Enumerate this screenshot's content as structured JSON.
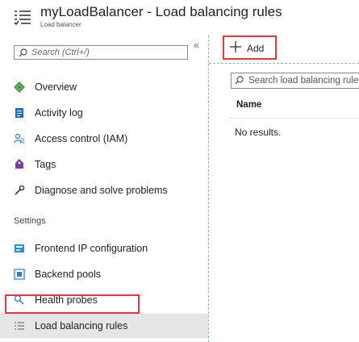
{
  "header": {
    "title": "myLoadBalancer - Load balancing rules",
    "subtitle": "Load balancer",
    "icon": "load-balancing-rules-icon"
  },
  "sidebar": {
    "collapse_glyph": "«",
    "search_placeholder": "Search (Ctrl+/)",
    "items": [
      {
        "label": "Overview",
        "icon": "overview-icon"
      },
      {
        "label": "Activity log",
        "icon": "activity-log-icon"
      },
      {
        "label": "Access control (IAM)",
        "icon": "access-control-icon"
      },
      {
        "label": "Tags",
        "icon": "tags-icon"
      },
      {
        "label": "Diagnose and solve problems",
        "icon": "wrench-icon"
      }
    ],
    "settings_title": "Settings",
    "settings_items": [
      {
        "label": "Frontend IP configuration",
        "icon": "frontend-ip-icon"
      },
      {
        "label": "Backend pools",
        "icon": "backend-pools-icon"
      },
      {
        "label": "Health probes",
        "icon": "health-probes-icon"
      },
      {
        "label": "Load balancing rules",
        "icon": "load-balancing-rules-icon",
        "selected": true
      }
    ]
  },
  "toolbar": {
    "add_label": "Add"
  },
  "content": {
    "search_placeholder": "Search load balancing rules",
    "columns": [
      "Name"
    ],
    "empty_text": "No results."
  },
  "colors": {
    "highlight": "#e0383e",
    "accent_blue": "#0078d4",
    "selected_bg": "#e6e6e6"
  }
}
